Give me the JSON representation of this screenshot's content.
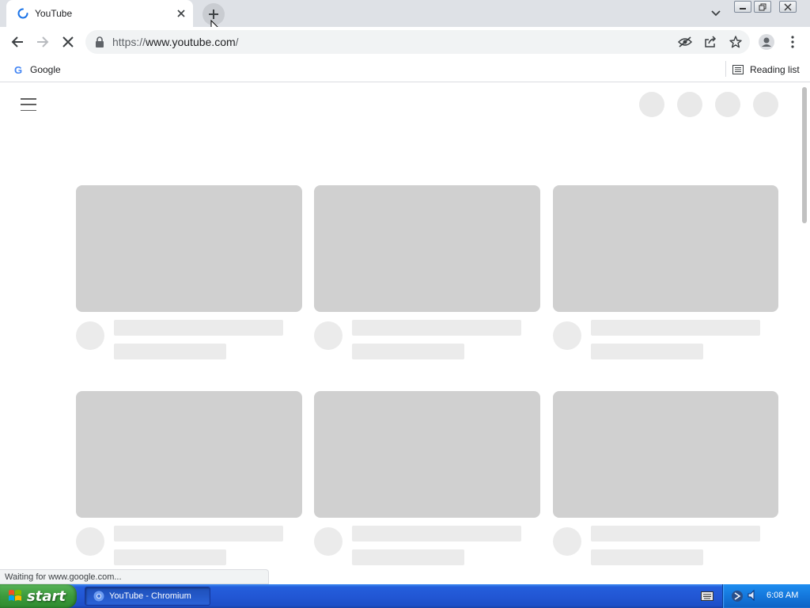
{
  "browser": {
    "tab": {
      "title": "YouTube"
    },
    "address": {
      "scheme": "https://",
      "host": "www.youtube.com",
      "path": "/"
    },
    "bookmarks": [
      {
        "label": "Google",
        "icon": "google-favicon-icon"
      }
    ],
    "reading_list": {
      "label": "Reading list",
      "icon": "reading-list-icon"
    },
    "status": "Waiting for www.google.com..."
  },
  "page": {
    "cards_rows": 2,
    "cards_per_row": 3,
    "placeholder_color": "#d0d0d0",
    "placeholder_light_color": "#ebebeb"
  },
  "taskbar": {
    "start_label": "start",
    "task_label": "YouTube - Chromium",
    "clock": "6:08 AM"
  }
}
